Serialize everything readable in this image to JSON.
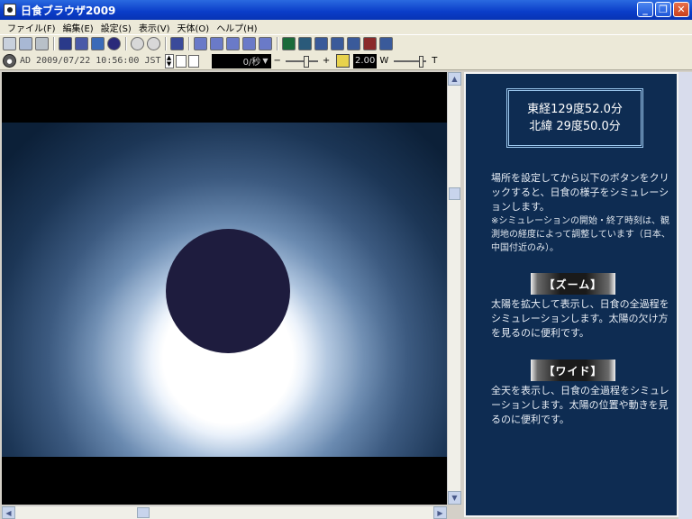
{
  "window": {
    "title": "日食ブラウザ2009",
    "controls": [
      "_",
      "❐",
      "✕"
    ]
  },
  "menu": [
    "ファイル(F)",
    "編集(E)",
    "設定(S)",
    "表示(V)",
    "天体(O)",
    "ヘルプ(H)"
  ],
  "toolbar2": {
    "era_label": "AD",
    "datetime": "2009/07/22  10:56:00 JST",
    "speed": "0/秒",
    "minus": "−",
    "plus": "+",
    "magnification": "2.00",
    "w_label": "W",
    "t_label": "T"
  },
  "panel": {
    "longitude": "東経129度52.0分",
    "latitude": "北緯 29度50.0分",
    "intro": "場所を設定してから以下のボタンをクリックすると、日食の様子をシミュレーションします。",
    "note": "※シミュレーションの開始・終了時刻は、観測地の経度によって調整しています（日本、中国付近のみ）。",
    "zoom_button": "【ズーム】",
    "zoom_desc": "太陽を拡大して表示し、日食の全過程をシミュレーションします。太陽の欠け方を見るのに便利です。",
    "wide_button": "【ワイド】",
    "wide_desc": "全天を表示し、日食の全過程をシミュレーションします。太陽の位置や動きを見るのに便利です。"
  },
  "colors": {
    "panel_bg": "#0e2c52",
    "titlebar": "#0a3cc8",
    "moon": "#1e1c3e"
  }
}
